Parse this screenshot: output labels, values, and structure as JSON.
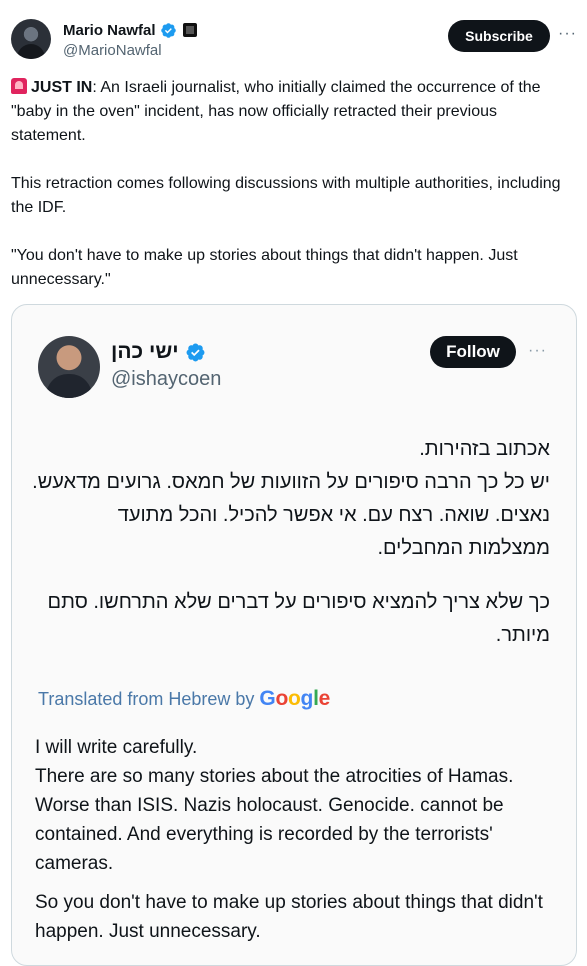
{
  "author": {
    "name": "Mario Nawfal",
    "handle": "@MarioNawfal",
    "verified_icon": "verified-badge-icon",
    "affiliate_icon": "affiliate-badge-icon"
  },
  "actions": {
    "subscribe_label": "Subscribe",
    "more_label": "···"
  },
  "tweet": {
    "alert_icon": "siren-emoji-icon",
    "lead": "JUST IN",
    "paragraph1_rest": ": An Israeli journalist, who initially claimed the occurrence of the \"baby in the oven\" incident, has now officially retracted their previous statement.",
    "paragraph2": "This retraction comes following discussions with multiple authorities, including the IDF.",
    "paragraph3": "\"You don't have to make up stories about things that didn't happen. Just unnecessary.\""
  },
  "embedded": {
    "name": "ישי כהן",
    "handle": "@ishaycoen",
    "follow_label": "Follow",
    "more_label": "···",
    "hebrew_paragraph1": "אכתוב בזהירות.\nיש כל כך הרבה סיפורים על הזוועות של חמאס. גרועים מדאעש. נאצים. שואה. רצח עם. אי אפשר להכיל. והכל מתועד ממצלמות המחבלים.",
    "hebrew_paragraph2": "כך שלא צריך להמציא סיפורים על דברים שלא התרחשו. סתם מיותר.",
    "translated_prefix": "Translated from Hebrew by",
    "google": [
      "G",
      "o",
      "o",
      "g",
      "l",
      "e"
    ],
    "english_paragraph1": "I will write carefully.\nThere are so many stories about the atrocities of Hamas. Worse than ISIS. Nazis holocaust. Genocide. cannot be contained. And everything is recorded by the terrorists' cameras.",
    "english_paragraph2": "So you don't have to make up stories about things that didn't happen. Just unnecessary."
  },
  "colors": {
    "verified_blue": "#1d9bf0",
    "text": "#0f1419",
    "muted": "#536471",
    "translated_link": "#4a78a8"
  }
}
